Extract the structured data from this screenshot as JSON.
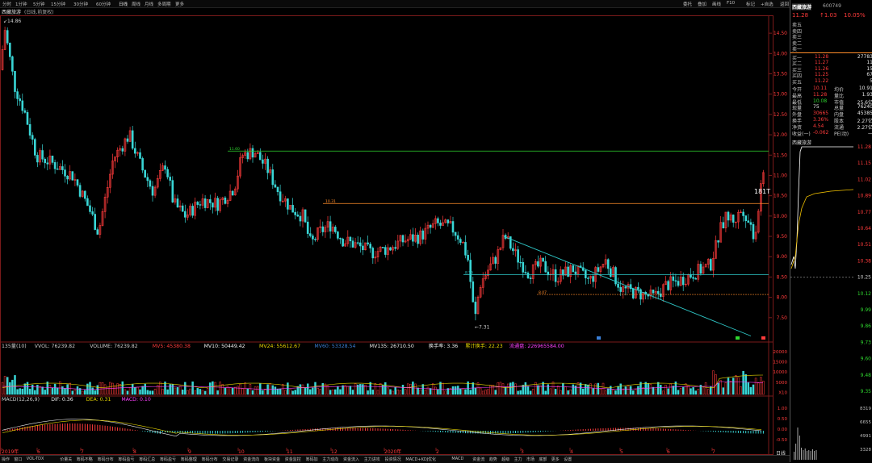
{
  "toolbar": {
    "periods": [
      "分时",
      "1分钟",
      "5分钟",
      "15分钟",
      "30分钟",
      "60分钟",
      "日线",
      "周线",
      "月线",
      "多周期",
      "更多"
    ],
    "active_period": "日线",
    "right_items": [
      "委托",
      "叠加",
      "画线",
      "F10",
      "标记",
      "+自选",
      "返回"
    ]
  },
  "title": {
    "name": "西藏旅游",
    "params": "(日线,前复权)"
  },
  "price_axis": [
    "14.50",
    "14.00",
    "13.50",
    "13.00",
    "12.50",
    "12.00",
    "11.50",
    "11.00",
    "10.50",
    "10.00",
    "9.50",
    "9.00",
    "8.50",
    "8.00",
    "7.50"
  ],
  "annotations": {
    "high": "14.86",
    "low": "7.31",
    "level_top": "11.60",
    "level_mid": "10.31",
    "level_low1": "8.56",
    "level_low2": "8.07",
    "marker_181t": "181T"
  },
  "volume_legend": {
    "prefix": "135量(10)",
    "vvol": "VVOL: 76239.82",
    "volume": "VOLUME: 76239.82",
    "mv5": "MV5: 45380.38",
    "mv10": "MV10: 50449.42",
    "mv24": "MV24: 55612.67",
    "mv60": "MV60: 53328.54",
    "mv135": "MV135: 26710.50",
    "turnover": "换手率: 3.36",
    "cum_turnover": "累计换手: 22.23",
    "float": "流通盘: 226965584.00"
  },
  "volume_axis": [
    "20000",
    "15000",
    "10000",
    "5000",
    "X10"
  ],
  "macd_legend": {
    "prefix": "MACD(12,26,9)",
    "dif": "DIF: 0.36",
    "dea": "DEA: 0.31",
    "macd": "MACD: 0.10"
  },
  "macd_axis": [
    "1.00",
    "0.50",
    "0.00",
    "-0.50"
  ],
  "time_axis": [
    "2019年",
    "6",
    "7",
    "8",
    "9",
    "10",
    "11",
    "12",
    "2020年",
    "2",
    "3",
    "4",
    "5",
    "6",
    "7"
  ],
  "tick_panel": {
    "name": "西藏旅游",
    "code": "600749",
    "price": "11.28",
    "change": "↑1.03",
    "pct": "10.05%",
    "asks": [
      {
        "label": "卖五",
        "price": "",
        "vol": ""
      },
      {
        "label": "卖四",
        "price": "",
        "vol": ""
      },
      {
        "label": "卖三",
        "price": "",
        "vol": ""
      },
      {
        "label": "卖二",
        "price": "",
        "vol": ""
      },
      {
        "label": "卖一",
        "price": "",
        "vol": ""
      }
    ],
    "bids": [
      {
        "label": "买一",
        "price": "11.28",
        "vol": "27783"
      },
      {
        "label": "买二",
        "price": "11.27",
        "vol": "11"
      },
      {
        "label": "买三",
        "price": "11.26",
        "vol": "15"
      },
      {
        "label": "买四",
        "price": "11.25",
        "vol": "67"
      },
      {
        "label": "买五",
        "price": "11.22",
        "vol": "5"
      }
    ],
    "stats": [
      {
        "k1": "今开",
        "v1": "10.11",
        "k2": "均价",
        "v2": "10.91"
      },
      {
        "k1": "最高",
        "v1": "11.28",
        "k2": "量比",
        "v2": "1.93"
      },
      {
        "k1": "最低",
        "v1": "10.08",
        "k2": "市值",
        "v2": "25.6亿"
      },
      {
        "k1": "现量",
        "v1": "75",
        "k2": "总量",
        "v2": "76240"
      },
      {
        "k1": "外盘",
        "v1": "30665",
        "k2": "内盘",
        "v2": "45385"
      },
      {
        "k1": "换手",
        "v1": "3.36%",
        "k2": "股本",
        "v2": "2.27亿"
      },
      {
        "k1": "净资",
        "v1": "4.54",
        "k2": "流通",
        "v2": "2.27亿"
      },
      {
        "k1": "收益(一)",
        "v1": "-0.062",
        "k2": "PE(动)",
        "v2": "一"
      }
    ],
    "mini_title": "西藏旅游",
    "mini_axis": [
      "11.28",
      "11.15",
      "11.02",
      "10.89",
      "10.77",
      "10.64",
      "10.51",
      "10.38",
      "10.25",
      "10.12",
      "9.99",
      "9.86",
      "9.73",
      "9.60",
      "9.48",
      "9.35"
    ],
    "mini_vol_axis": [
      "8319",
      "6655",
      "4991",
      "3328",
      "1664"
    ],
    "daily_label": "日线"
  },
  "bottom_tabs": [
    "操作",
    "窗口",
    "VOL-TDX",
    "价量关",
    "筹码不略",
    "筹码分布",
    "筹码盈亏",
    "筹码汇总",
    "筹码盈亏",
    "筹码整理",
    "筹码分布",
    "交易记录",
    "资金流向",
    "板块资金",
    "资金监控",
    "筹码加",
    "主力动向",
    "资金流入",
    "主力进攻",
    "投资情况",
    "MACD+KDJ优化",
    "MACD",
    "资金流",
    "趋势",
    "超级",
    "主力",
    "市场",
    "底部",
    "更多",
    "设置"
  ],
  "colors": {
    "up": "#ff3b3b",
    "down": "#39d6d6",
    "level_line": "#2fd62f",
    "orange_line": "#ff8c2a",
    "trend_line": "#2ec7c7"
  }
}
